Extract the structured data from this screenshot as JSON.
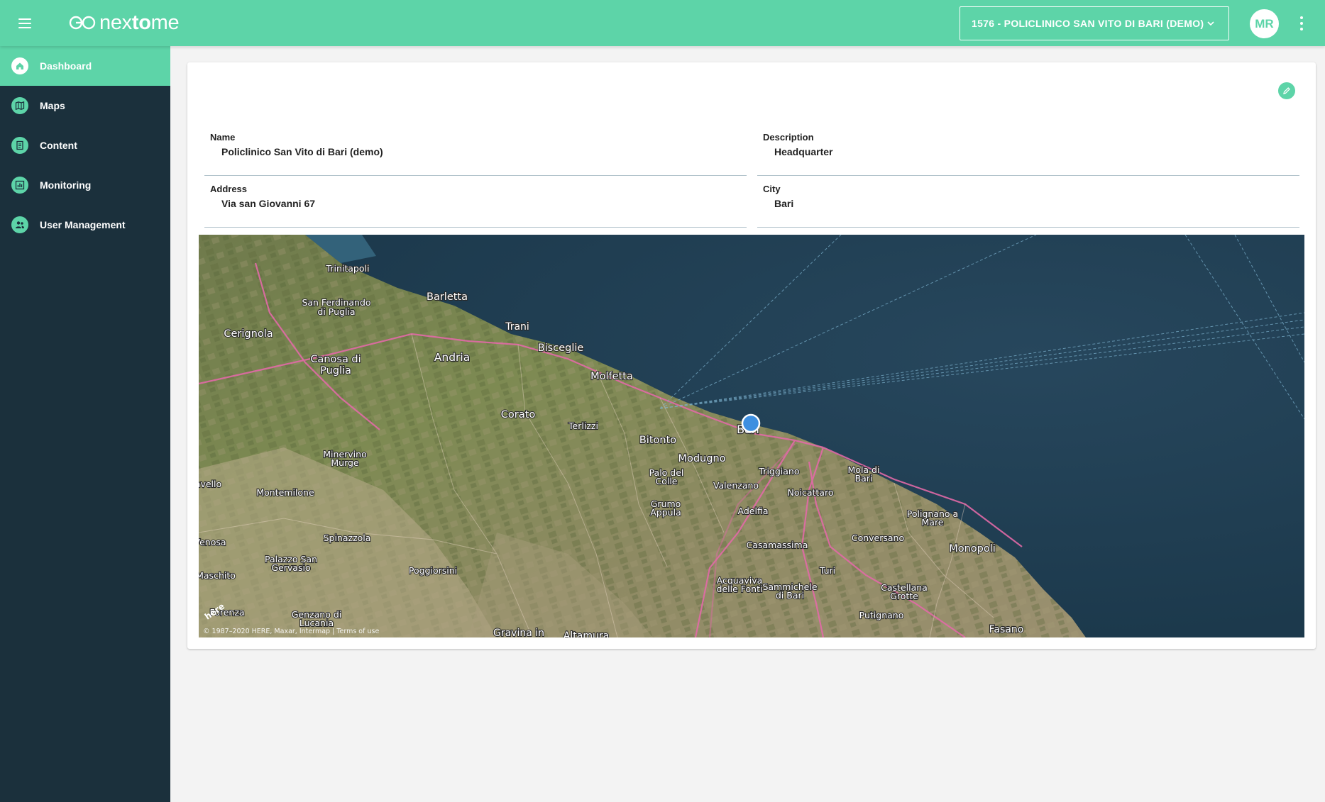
{
  "app": {
    "logo_text_light": "nex",
    "logo_text_bold": "to",
    "logo_text_end": "me",
    "brand_color": "#5dd4a8",
    "sidebar_color": "#1b303c"
  },
  "header": {
    "venue_selected": "1576 - POLICLINICO SAN VITO DI BARI (DEMO)",
    "avatar_initials": "MR"
  },
  "sidebar": {
    "items": [
      {
        "label": "Dashboard",
        "icon": "home-icon",
        "active": true
      },
      {
        "label": "Maps",
        "icon": "map-icon"
      },
      {
        "label": "Content",
        "icon": "document-icon"
      },
      {
        "label": "Monitoring",
        "icon": "chart-icon"
      },
      {
        "label": "User Management",
        "icon": "users-icon"
      }
    ]
  },
  "venue": {
    "name_label": "Name",
    "name_value": "Policlinico San Vito di Bari (demo)",
    "description_label": "Description",
    "description_value": "Headquarter",
    "address_label": "Address",
    "address_value": "Via san Giovanni 67",
    "city_label": "City",
    "city_value": "Bari"
  },
  "map": {
    "marker_label": "Bari",
    "attribution": "© 1987–2020 HERE, Maxar, Intermap | Terms of use",
    "here_logo": "here",
    "places": [
      "Trinitapoli",
      "Barletta",
      "San Ferdinando di Puglia",
      "Cerignola",
      "Trani",
      "Bisceglie",
      "Andria",
      "Canosa di Puglia",
      "Molfetta",
      "Corato",
      "Terlizzi",
      "Bitonto",
      "Modugno",
      "Palo del Colle",
      "Triggiano",
      "Valenzano",
      "Noicattaro",
      "Mola di Bari",
      "Minervino Murge",
      "Montemilone",
      "Grumo Appula",
      "Adelfia",
      "Polignano a Mare",
      "Conversano",
      "Casamassima",
      "Monopoli",
      "Spinazzola",
      "Palazzo San Gervasio",
      "Poggiorsini",
      "Turi",
      "Acquaviva delle Fonti",
      "Sammichele di Bari",
      "Castellana Grotte",
      "Putignano",
      "Genzano di Lucania",
      "Gravina in",
      "Altamura",
      "Fasano",
      "Maschito",
      "Venosa",
      "Lavello",
      "Forenza"
    ]
  }
}
